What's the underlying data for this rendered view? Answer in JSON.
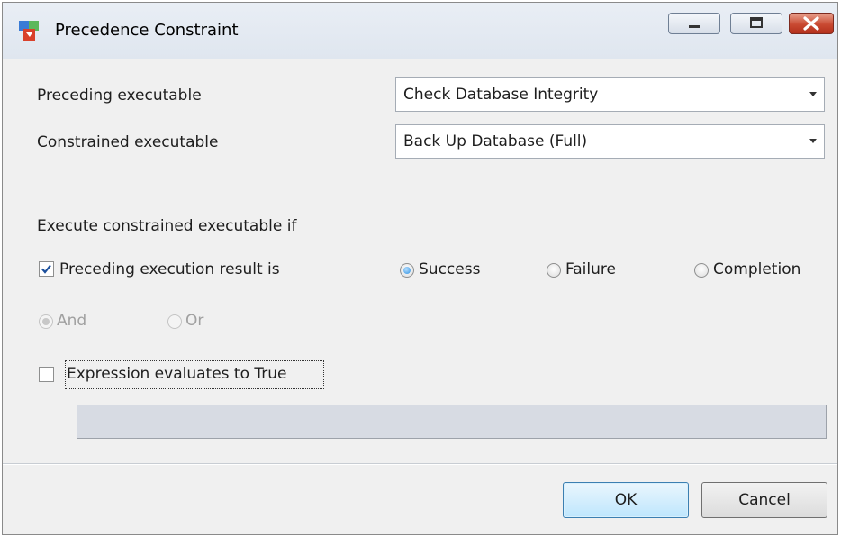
{
  "window": {
    "title": "Precedence Constraint",
    "icon": "precedence-constraint-icon",
    "controls": [
      "minimize-icon",
      "maximize-icon",
      "close-icon"
    ]
  },
  "form": {
    "preceding_label": "Preceding executable",
    "preceding_value": "Check Database Integrity",
    "constrained_label": "Constrained executable",
    "constrained_value": "Back Up Database (Full)",
    "section_label": "Execute constrained executable if",
    "result_check_label": "Preceding execution result is",
    "result_checked": true,
    "result_options": [
      {
        "label": "Success",
        "selected": true
      },
      {
        "label": "Failure",
        "selected": false
      },
      {
        "label": "Completion",
        "selected": false
      }
    ],
    "logic_options": [
      {
        "label": "And",
        "selected": true,
        "enabled": false
      },
      {
        "label": "Or",
        "selected": false,
        "enabled": false
      }
    ],
    "expression_check_label": "Expression evaluates to True",
    "expression_checked": false,
    "expression_value": ""
  },
  "buttons": {
    "ok": "OK",
    "cancel": "Cancel"
  },
  "colors": {
    "title_bar": "#dfe6ef",
    "close_button": "#c94a32",
    "radio_selected": "#2c8fe0",
    "ok_button_border": "#3c7fb1",
    "disabled_text": "#a0a0a0"
  }
}
